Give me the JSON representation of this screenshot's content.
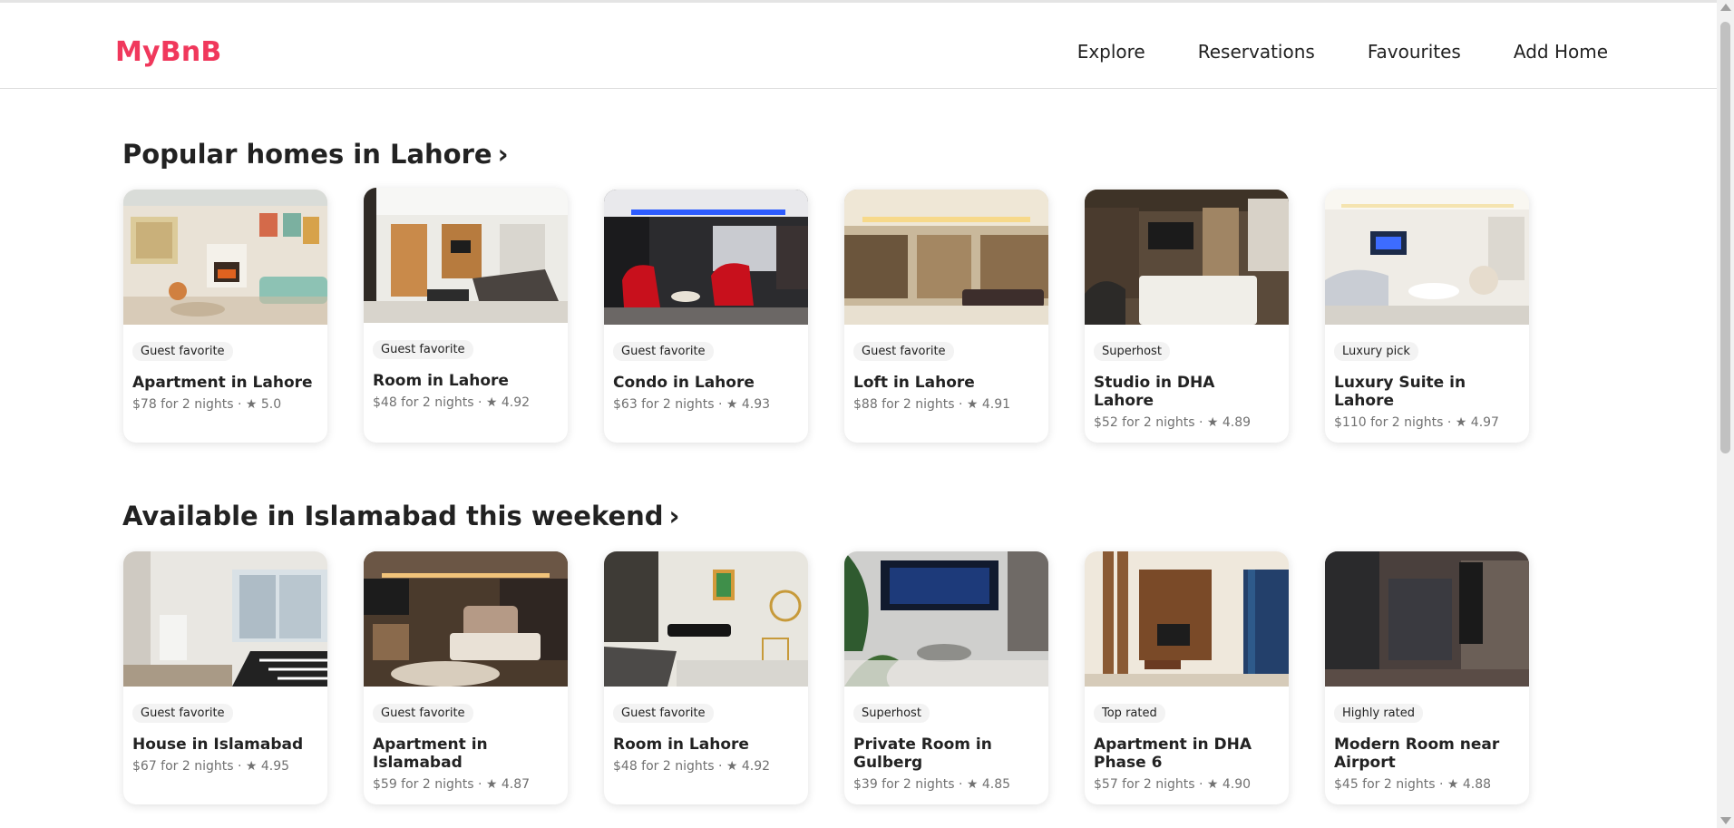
{
  "app": {
    "logo": "MyBnB",
    "brand_color": "#f0385c"
  },
  "nav": {
    "items": [
      {
        "label": "Explore"
      },
      {
        "label": "Reservations"
      },
      {
        "label": "Favourites"
      },
      {
        "label": "Add Home"
      }
    ]
  },
  "sections": [
    {
      "title": "Popular homes in Lahore",
      "chevron": "›",
      "cards": [
        {
          "badge": "Guest favorite",
          "title": "Apartment in Lahore",
          "meta": "$78 for 2 nights · ★ 5.0",
          "image": "living-room-art-icon"
        },
        {
          "badge": "Guest favorite",
          "title": "Room in Lahore",
          "meta": "$48 for 2 nights · ★ 4.92",
          "image": "lounge-room-icon"
        },
        {
          "badge": "Guest favorite",
          "title": "Condo in Lahore",
          "meta": "$63 for 2 nights · ★ 4.93",
          "image": "red-chairs-room-icon"
        },
        {
          "badge": "Guest favorite",
          "title": "Loft in Lahore",
          "meta": "$88 for 2 nights · ★ 4.91",
          "image": "lit-ceiling-room-icon"
        },
        {
          "badge": "Superhost",
          "title": "Studio in DHA Lahore",
          "meta": "$52 for 2 nights · ★ 4.89",
          "image": "studio-bed-icon"
        },
        {
          "badge": "Luxury pick",
          "title": "Luxury Suite in Lahore",
          "meta": "$110 for 2 nights · ★ 4.97",
          "image": "white-suite-icon"
        }
      ]
    },
    {
      "title": "Available in Islamabad this weekend",
      "chevron": "›",
      "cards": [
        {
          "badge": "Guest favorite",
          "title": "House in Islamabad",
          "meta": "$67 for 2 nights · ★ 4.95",
          "image": "bright-house-icon"
        },
        {
          "badge": "Guest favorite",
          "title": "Apartment in Islamabad",
          "meta": "$59 for 2 nights · ★ 4.87",
          "image": "warm-bedroom-icon"
        },
        {
          "badge": "Guest favorite",
          "title": "Room in Lahore",
          "meta": "$48 for 2 nights · ★ 4.92",
          "image": "bench-bedroom-icon"
        },
        {
          "badge": "Superhost",
          "title": "Private Room in Gulberg",
          "meta": "$39 for 2 nights · ★ 4.85",
          "image": "plant-lounge-icon"
        },
        {
          "badge": "Top rated",
          "title": "Apartment in DHA Phase 6",
          "meta": "$57 for 2 nights · ★ 4.90",
          "image": "wood-panel-room-icon"
        },
        {
          "badge": "Highly rated",
          "title": "Modern Room near Airport",
          "meta": "$45 for 2 nights · ★ 4.88",
          "image": "dark-room-icon"
        }
      ]
    }
  ]
}
